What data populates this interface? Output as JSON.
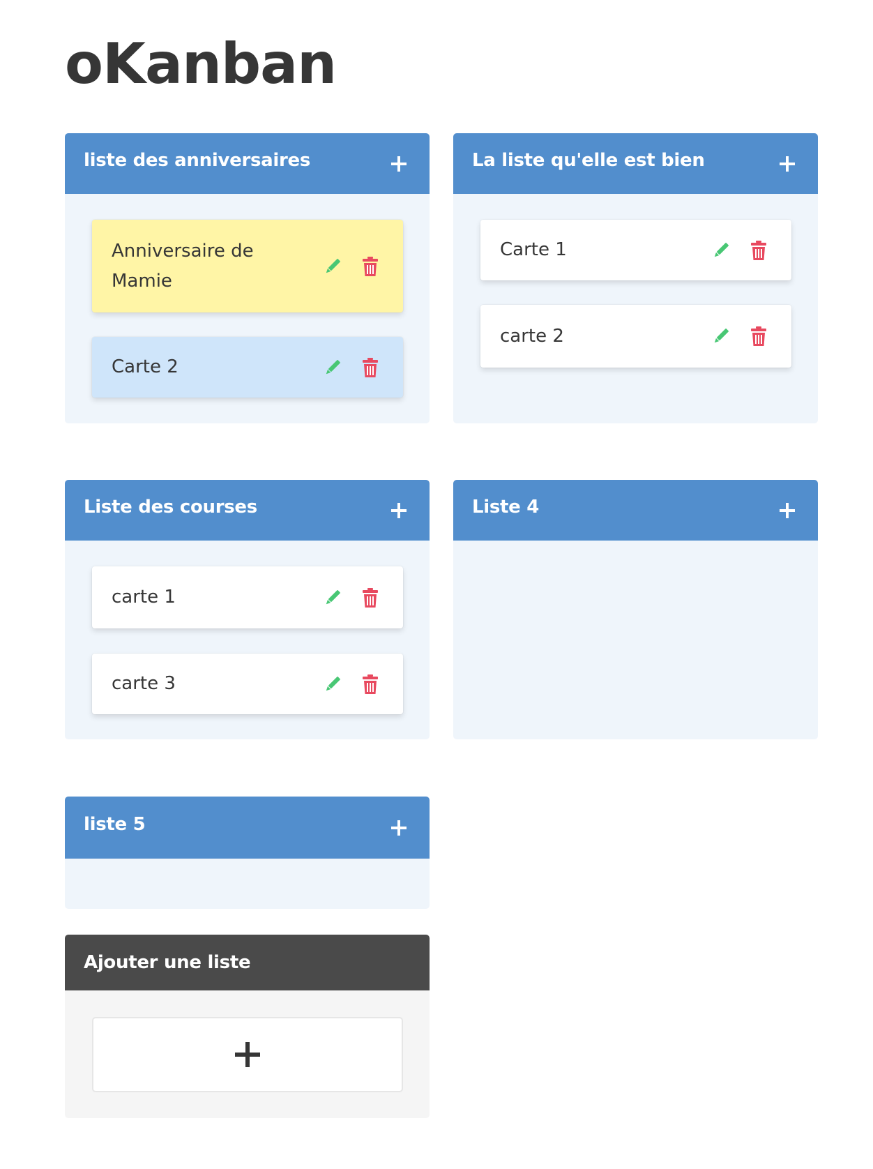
{
  "app": {
    "title": "oKanban"
  },
  "colors": {
    "list_header": "#528ecd",
    "list_body": "#eff5fb",
    "card_default": "#ffffff",
    "card_yellow": "#fff5a6",
    "card_blue": "#cfe5fa",
    "edit_icon": "#48c774",
    "delete_icon": "#e8495f",
    "add_list_header": "#4a4a4a",
    "add_list_body": "#f5f5f5"
  },
  "lists": [
    {
      "title": "liste des anniversaires",
      "add_icon": "plus-icon",
      "cards": [
        {
          "text": "Anniversaire de Mamie",
          "color": "yellow",
          "edit_icon": "pencil-icon",
          "delete_icon": "trash-icon"
        },
        {
          "text": "Carte 2",
          "color": "blue",
          "edit_icon": "pencil-icon",
          "delete_icon": "trash-icon"
        }
      ]
    },
    {
      "title": "La liste qu'elle est bien",
      "add_icon": "plus-icon",
      "cards": [
        {
          "text": "Carte 1",
          "color": "white",
          "edit_icon": "pencil-icon",
          "delete_icon": "trash-icon"
        },
        {
          "text": "carte 2",
          "color": "white",
          "edit_icon": "pencil-icon",
          "delete_icon": "trash-icon"
        }
      ]
    },
    {
      "title": "Liste des courses",
      "add_icon": "plus-icon",
      "cards": [
        {
          "text": "carte 1",
          "color": "white",
          "edit_icon": "pencil-icon",
          "delete_icon": "trash-icon"
        },
        {
          "text": "carte 3",
          "color": "white",
          "edit_icon": "pencil-icon",
          "delete_icon": "trash-icon"
        }
      ]
    },
    {
      "title": "Liste 4",
      "add_icon": "plus-icon",
      "cards": []
    },
    {
      "title": "liste 5",
      "add_icon": "plus-icon",
      "cards": []
    }
  ],
  "add_list": {
    "title": "Ajouter une liste",
    "icon": "plus-icon"
  }
}
